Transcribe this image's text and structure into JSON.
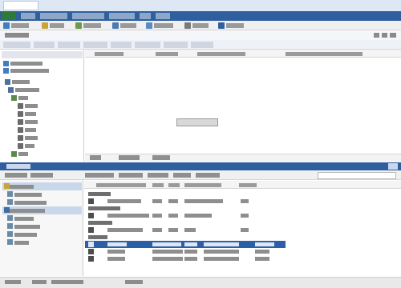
{
  "window": {
    "title": ""
  },
  "menubar": {
    "items": [
      {
        "label": ""
      },
      {
        "label": ""
      },
      {
        "label": ""
      },
      {
        "label": ""
      },
      {
        "label": ""
      },
      {
        "label": ""
      }
    ]
  },
  "toolbar": {
    "buttons": [
      {
        "icon": "",
        "label": ""
      },
      {
        "icon": "",
        "label": ""
      },
      {
        "icon": "",
        "label": ""
      },
      {
        "icon": "",
        "label": ""
      },
      {
        "icon": "",
        "label": ""
      },
      {
        "icon": "",
        "label": ""
      },
      {
        "icon": "",
        "label": ""
      }
    ]
  },
  "breadcrumb": "",
  "filters": [
    {
      "label": ""
    },
    {
      "label": ""
    },
    {
      "label": ""
    },
    {
      "label": ""
    },
    {
      "label": ""
    },
    {
      "label": ""
    },
    {
      "label": ""
    },
    {
      "label": ""
    }
  ],
  "tree": {
    "header": "",
    "items": [
      {
        "label": ""
      },
      {
        "label": ""
      },
      {
        "label": ""
      },
      {
        "label": ""
      },
      {
        "label": ""
      },
      {
        "label": ""
      },
      {
        "label": ""
      },
      {
        "label": ""
      },
      {
        "label": ""
      },
      {
        "label": ""
      },
      {
        "label": ""
      },
      {
        "label": ""
      },
      {
        "label": ""
      }
    ]
  },
  "table": {
    "columns": [
      {
        "label": ""
      },
      {
        "label": ""
      },
      {
        "label": ""
      },
      {
        "label": ""
      }
    ]
  },
  "center_button": "",
  "upper_tabs": [
    {
      "label": ""
    },
    {
      "label": ""
    },
    {
      "label": ""
    }
  ],
  "panel": {
    "title": "",
    "toolbar": [
      {
        "label": ""
      },
      {
        "label": ""
      },
      {
        "label": ""
      },
      {
        "label": ""
      },
      {
        "label": ""
      },
      {
        "label": ""
      },
      {
        "label": ""
      }
    ],
    "search_placeholder": "",
    "nav": [
      {
        "label": ""
      },
      {
        "label": ""
      },
      {
        "label": ""
      },
      {
        "label": ""
      },
      {
        "label": ""
      },
      {
        "label": ""
      },
      {
        "label": ""
      },
      {
        "label": ""
      },
      {
        "label": ""
      },
      {
        "label": ""
      }
    ],
    "columns": [
      {
        "label": ""
      },
      {
        "label": ""
      },
      {
        "label": ""
      },
      {
        "label": ""
      },
      {
        "label": ""
      }
    ],
    "groups": [
      {
        "label": "",
        "rows": [
          {
            "cells": [
              "",
              "",
              "",
              "",
              ""
            ]
          }
        ]
      },
      {
        "label": "",
        "rows": [
          {
            "cells": [
              "",
              "",
              "",
              "",
              ""
            ]
          }
        ]
      },
      {
        "label": "",
        "rows": [
          {
            "cells": [
              "",
              "",
              "",
              "",
              ""
            ]
          }
        ]
      },
      {
        "label": "",
        "rows": [
          {
            "cells": [
              "",
              "",
              "",
              "",
              ""
            ],
            "selected": true
          },
          {
            "cells": [
              "",
              "",
              "",
              "",
              ""
            ]
          },
          {
            "cells": [
              "",
              "",
              "",
              "",
              ""
            ]
          }
        ]
      }
    ]
  },
  "status": [
    {
      "label": ""
    },
    {
      "label": ""
    },
    {
      "label": ""
    },
    {
      "label": ""
    }
  ],
  "colors": {
    "accent": "#2f5f9e",
    "selection": "#2c5fa5",
    "app_button": "#2f7a3a"
  }
}
